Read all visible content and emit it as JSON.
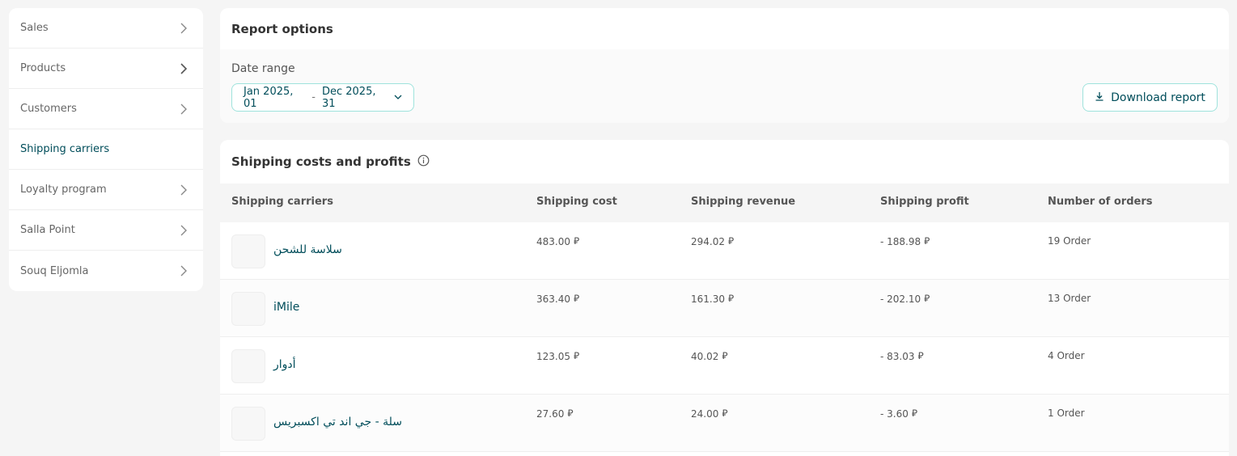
{
  "sidebar": {
    "items": [
      {
        "label": "Sales",
        "active": false
      },
      {
        "label": "Products",
        "active": false
      },
      {
        "label": "Customers",
        "active": false
      },
      {
        "label": "Shipping carriers",
        "active": true
      },
      {
        "label": "Loyalty program",
        "active": false
      },
      {
        "label": "Salla Point",
        "active": false
      },
      {
        "label": "Souq Eljomla",
        "active": false
      }
    ]
  },
  "report_options": {
    "title": "Report options",
    "date_range_label": "Date range",
    "date_start": "Jan 2025, 01",
    "date_separator": "-",
    "date_end": "Dec 2025, 31",
    "download_label": "Download report"
  },
  "shipping": {
    "title": "Shipping costs and profits",
    "currency_symbol": "⃁",
    "columns": [
      "Shipping carriers",
      "Shipping cost",
      "Shipping revenue",
      "Shipping profit",
      "Number of orders"
    ],
    "rows": [
      {
        "carrier": "سلاسة للشحن",
        "cost": "483.00",
        "revenue": "294.02",
        "profit": "- 188.98",
        "orders": "19 Order"
      },
      {
        "carrier": "iMile",
        "cost": "363.40",
        "revenue": "161.30",
        "profit": "- 202.10",
        "orders": "13 Order"
      },
      {
        "carrier": "أدوار",
        "cost": "123.05",
        "revenue": "40.02",
        "profit": "- 83.03",
        "orders": "4 Order"
      },
      {
        "carrier": "سلة - جي اند تي اكسبريس",
        "cost": "27.60",
        "revenue": "24.00",
        "profit": "- 3.60",
        "orders": "1 Order"
      }
    ]
  },
  "colors": {
    "accent": "#004d5a",
    "border_accent": "#9fe3dc",
    "background": "#f5f5f5"
  }
}
